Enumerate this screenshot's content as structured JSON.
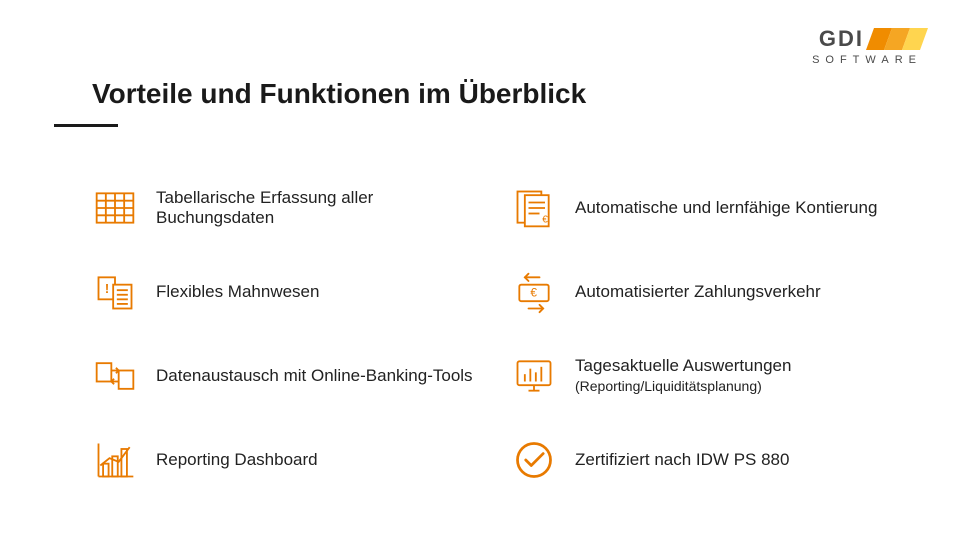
{
  "brand": {
    "name": "GDI",
    "sub": "SOFTWARE"
  },
  "title": "Vorteile und Funktionen im Überblick",
  "features": [
    {
      "icon": "table",
      "text": "Tabellarische Erfassung aller Buchungsdaten"
    },
    {
      "icon": "invoice",
      "text": "Automatische und lernfähige Kontierung"
    },
    {
      "icon": "dunning",
      "text": "Flexibles Mahnwesen"
    },
    {
      "icon": "payments",
      "text": "Automatisierter Zahlungsverkehr"
    },
    {
      "icon": "exchange",
      "text": "Datenaustausch mit Online-Banking-Tools"
    },
    {
      "icon": "screen-chart",
      "text": "Tagesaktuelle Auswertungen",
      "sub": "(Reporting/Liquiditätsplanung)"
    },
    {
      "icon": "bars",
      "text": "Reporting Dashboard"
    },
    {
      "icon": "check",
      "text": "Zertifiziert nach IDW PS 880"
    }
  ]
}
